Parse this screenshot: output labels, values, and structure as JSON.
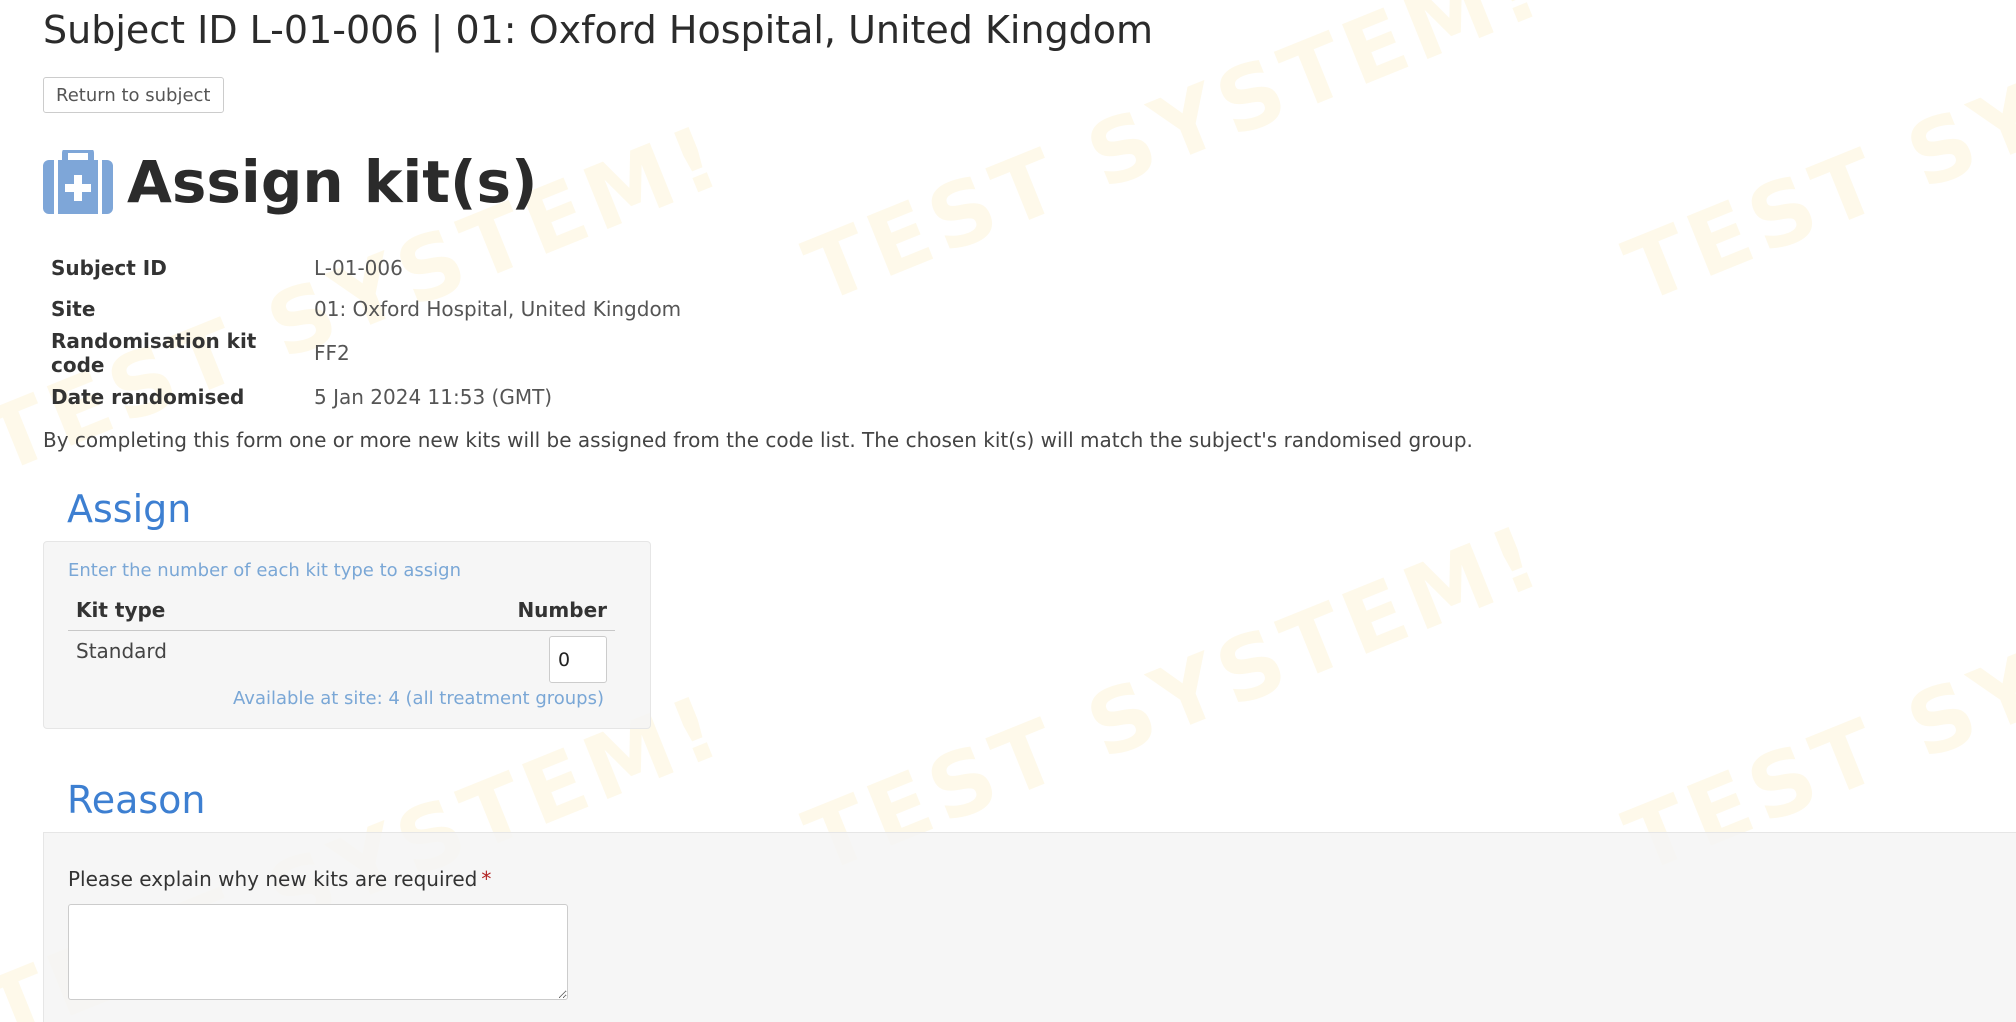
{
  "header": {
    "title": "Subject ID L-01-006 | 01: Oxford Hospital, United Kingdom",
    "return_button": "Return to subject"
  },
  "watermark": {
    "text": "TEST SYSTEM!"
  },
  "main": {
    "heading": "Assign kit(s)",
    "icon": "medical-kit-icon",
    "details": [
      {
        "label": "Subject ID",
        "value": "L-01-006"
      },
      {
        "label": "Site",
        "value": "01: Oxford Hospital, United Kingdom"
      },
      {
        "label": "Randomisation kit code",
        "value": "FF2"
      },
      {
        "label": "Date randomised",
        "value": "5 Jan 2024 11:53 (GMT)"
      }
    ],
    "intro": "By completing this form one or more new kits will be assigned from the code list. The chosen kit(s) will match the subject's randomised group."
  },
  "assign": {
    "title": "Assign",
    "hint": "Enter the number of each kit type to assign",
    "columns": {
      "kit_type": "Kit type",
      "number": "Number"
    },
    "rows": [
      {
        "kit_type": "Standard",
        "number": "0"
      }
    ],
    "available": "Available at site: 4 (all treatment groups)"
  },
  "reason": {
    "title": "Reason",
    "label": "Please explain why new kits are required",
    "required_marker": "*",
    "value": ""
  },
  "colors": {
    "accent": "#3d7fd1",
    "hint": "#7aa7d6",
    "icon": "#7ea6d8",
    "required": "#b22222",
    "watermark": "#fae2a0"
  }
}
